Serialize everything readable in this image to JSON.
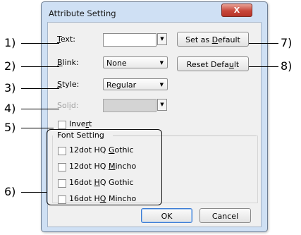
{
  "window": {
    "title": "Attribute Setting",
    "close_label": "X"
  },
  "fields": {
    "text": {
      "label": "Text:",
      "mnemonic": "T",
      "value": ""
    },
    "blink": {
      "label": "Blink:",
      "mnemonic": "B",
      "value": "None"
    },
    "style": {
      "label": "Style:",
      "mnemonic": "S",
      "value": "Regular"
    },
    "solid": {
      "label": "Solid:",
      "mnemonic": "i",
      "value": ""
    }
  },
  "buttons": {
    "set_as_default": "Set as Default",
    "reset_default": "Reset Default",
    "ok": "OK",
    "cancel": "Cancel"
  },
  "invert": {
    "label": "Invert",
    "checked": false
  },
  "font_setting": {
    "title": "Font Setting",
    "options": [
      {
        "label": "12dot HQ Gothic",
        "checked": false
      },
      {
        "label": "12dot HQ Mincho",
        "checked": false
      },
      {
        "label": "16dot HQ Gothic",
        "checked": false
      },
      {
        "label": "16dot HQ Mincho",
        "checked": false
      }
    ]
  },
  "callouts": [
    "1)",
    "2)",
    "3)",
    "4)",
    "5)",
    "6)",
    "7)",
    "8)"
  ]
}
